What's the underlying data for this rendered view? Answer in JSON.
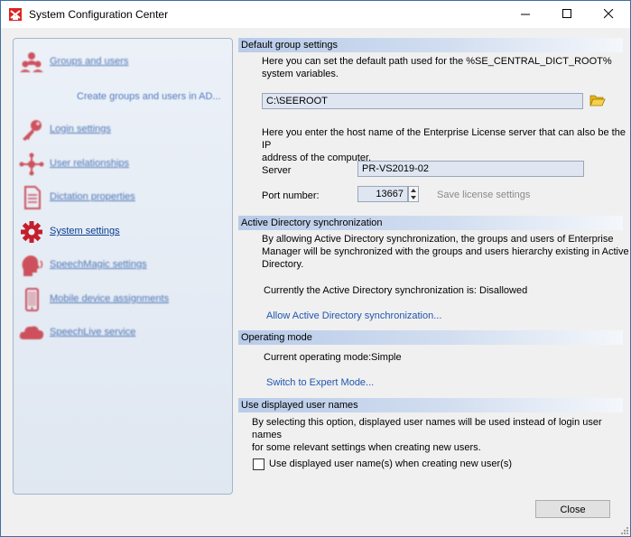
{
  "window": {
    "title": "System Configuration Center"
  },
  "sidebar": {
    "items": [
      {
        "label": "Groups and users",
        "icon": "users-icon"
      },
      {
        "label": "Login settings",
        "icon": "key-icon"
      },
      {
        "label": "User relationships",
        "icon": "relationship-icon"
      },
      {
        "label": "Dictation properties",
        "icon": "document-icon"
      },
      {
        "label": "System settings",
        "icon": "gear-icon"
      },
      {
        "label": "SpeechMagic settings",
        "icon": "speech-head-icon"
      },
      {
        "label": "Mobile device assignments",
        "icon": "mobile-phone-icon"
      },
      {
        "label": "SpeechLive service",
        "icon": "cloud-icon"
      }
    ],
    "sub_item": "Create groups and users in AD..."
  },
  "default_group": {
    "header": "Default group settings",
    "desc_line1": "Here you can set the default path used for the %SE_CENTRAL_DICT_ROOT%",
    "desc_line2": "system variables.",
    "path_value": "C:\\SEEROOT",
    "license_desc_line1": "Here you enter the host name of the Enterprise License server that can also be the IP",
    "license_desc_line2": "address of the computer.",
    "server_label": "Server",
    "server_value": "PR-VS2019-02",
    "port_label": "Port number:",
    "port_value": "13667",
    "save_license_label": "Save license settings"
  },
  "ad_sync": {
    "header": "Active Directory synchronization",
    "desc_line1": "By allowing Active Directory synchronization, the groups and users of Enterprise",
    "desc_line2": "Manager will be synchronized  with the groups and users hierarchy existing in Active",
    "desc_line3": "Directory.",
    "status_text": "Currently the Active Directory synchronization is:  Disallowed",
    "allow_link": "Allow Active Directory synchronization..."
  },
  "operating_mode": {
    "header": "Operating mode",
    "current_label": "Current operating mode:",
    "current_value": "Simple",
    "switch_link": "Switch to Expert Mode..."
  },
  "display_names": {
    "header": "Use displayed user names",
    "desc_line1": "By selecting this option, displayed user names will be used instead of login user names",
    "desc_line2": "for some relevant settings when creating new users.",
    "checkbox_label": "Use displayed user name(s) when creating new user(s)",
    "checked": false
  },
  "footer": {
    "close_label": "Close"
  }
}
